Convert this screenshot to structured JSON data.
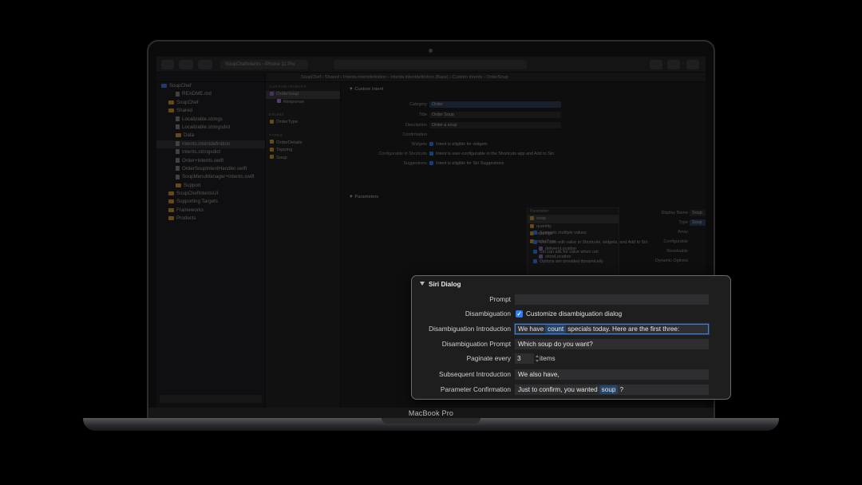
{
  "device": {
    "brand_label": "MacBook Pro"
  },
  "toolbar": {
    "scheme": "SoupChefIntents  ›  iPhone 11 Pro"
  },
  "jumpbar": {
    "path": "SoupChef  ›  Shared  ›  Intents.intentdefinition  ›  Intents.intentdefinition (Base)  ›  Custom Intents  ›  OrderSoup"
  },
  "navigator": {
    "items": [
      {
        "label": "SoupChef",
        "indent": 0,
        "kind": "project"
      },
      {
        "label": "README.md",
        "indent": 2,
        "kind": "file"
      },
      {
        "label": "SoupChef",
        "indent": 1,
        "kind": "folder"
      },
      {
        "label": "Shared",
        "indent": 1,
        "kind": "folder"
      },
      {
        "label": "Localizable.strings",
        "indent": 2,
        "kind": "file"
      },
      {
        "label": "Localizable.stringsdict",
        "indent": 2,
        "kind": "file"
      },
      {
        "label": "Data",
        "indent": 2,
        "kind": "folder"
      },
      {
        "label": "Intents.intentdefinition",
        "indent": 2,
        "kind": "file",
        "selected": true
      },
      {
        "label": "Intents.stringsdict",
        "indent": 2,
        "kind": "file"
      },
      {
        "label": "Order+Intents.swift",
        "indent": 2,
        "kind": "file"
      },
      {
        "label": "OrderSoupIntentHandler.swift",
        "indent": 2,
        "kind": "file"
      },
      {
        "label": "SoupMenuManager+Intents.swift",
        "indent": 2,
        "kind": "file"
      },
      {
        "label": "Support",
        "indent": 2,
        "kind": "folder"
      },
      {
        "label": "SoupChefIntentsUI",
        "indent": 1,
        "kind": "folder"
      },
      {
        "label": "Supporting Targets",
        "indent": 1,
        "kind": "folder"
      },
      {
        "label": "Frameworks",
        "indent": 1,
        "kind": "folder"
      },
      {
        "label": "Products",
        "indent": 1,
        "kind": "folder"
      }
    ]
  },
  "outline": {
    "custom_intents_header": "CUSTOM INTENTS",
    "order_soup": "OrderSoup",
    "response": "Response",
    "enums_header": "ENUMS",
    "order_type": "OrderType",
    "types_header": "TYPES",
    "order_details": "OrderDetails",
    "topping": "Topping",
    "soup": "Soup"
  },
  "custom_intent": {
    "header": "Custom Intent",
    "category_label": "Category",
    "category_value": "Order",
    "title_label": "Title",
    "title_value": "Order Soup",
    "description_label": "Description",
    "description_value": "Order a soup",
    "confirmation_label": "Confirmation",
    "widgets_label": "Widgets",
    "widgets_check": "Intent is eligible for widgets",
    "configurable_label": "Configurable in Shortcuts",
    "configurable_check": "Intent is user-configurable in the Shortcuts app and Add to Siri",
    "suggestions_label": "Suggestions",
    "suggestions_check": "Intent is eligible for Siri Suggestions"
  },
  "parameters": {
    "header": "Parameters",
    "table_header": "Parameter",
    "rows": [
      "soup",
      "quantity",
      "toppings",
      "orderType",
      "deliveryLocation",
      "storeLocation"
    ],
    "display_name_label": "Display Name",
    "display_name_value": "Soup",
    "type_label": "Type",
    "type_value": "Soup",
    "array_label": "Array",
    "array_check": "Supports multiple values",
    "configurable_label": "Configurable",
    "configurable_check": "User can edit value in Shortcuts, widgets, and Add to Siri",
    "resolvable_label": "Resolvable",
    "resolvable_check": "Siri can ask for value when run",
    "dynamic_label": "Dynamic Options",
    "dynamic_check": "Options are provided dynamically"
  },
  "siri_dialog": {
    "title": "Siri Dialog",
    "prompt_label": "Prompt",
    "prompt_value": "",
    "disambiguation_label": "Disambiguation",
    "disambiguation_check": "Customize disambiguation dialog",
    "intro_label": "Disambiguation Introduction",
    "intro_before": "We have",
    "intro_token": "count",
    "intro_after": "specials today. Here are the first three:",
    "dis_prompt_label": "Disambiguation Prompt",
    "dis_prompt_value": "Which soup do you want?",
    "paginate_label": "Paginate every",
    "paginate_value": "3",
    "paginate_unit": "items",
    "subsequent_label": "Subsequent Introduction",
    "subsequent_value": "We also have,",
    "confirm_label": "Parameter Confirmation",
    "confirm_before": "Just to confirm, you wanted",
    "confirm_token": "soup",
    "confirm_after": "?"
  }
}
